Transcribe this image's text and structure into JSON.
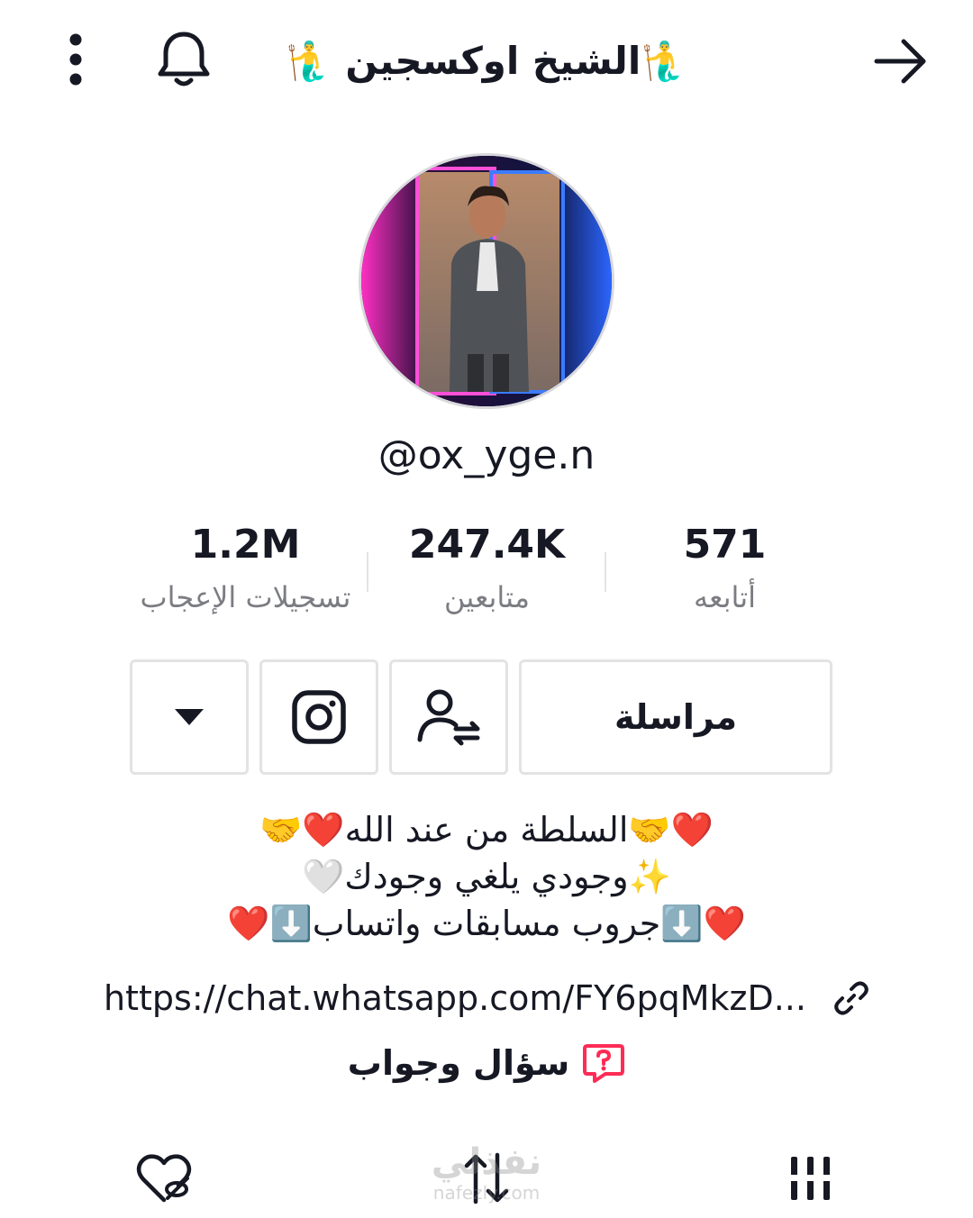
{
  "header": {
    "title": "🧜‍♂️الشيخ اوكسجين 🧜‍♂️"
  },
  "profile": {
    "username": "@ox_yge.n"
  },
  "stats": [
    {
      "value": "1.2M",
      "label": "تسجيلات الإعجاب"
    },
    {
      "value": "247.4K",
      "label": "متابعين"
    },
    {
      "value": "571",
      "label": "أتابعه"
    }
  ],
  "actions": {
    "message_label": "مراسلة"
  },
  "bio": {
    "lines": [
      "❤️🤝السلطة من عند الله❤️🤝",
      "✨وجودي يلغي وجودك🤍",
      "❤️⬇️جروب مسابقات واتساب⬇️❤️"
    ]
  },
  "link": {
    "text": "https://chat.whatsapp.com/FY6pqMkzD..."
  },
  "qa": {
    "label": "سؤال وجواب"
  },
  "watermark": {
    "ar": "نفذلي",
    "en": "nafezly.com"
  },
  "colors": {
    "text": "#161823",
    "muted": "#7c7d83",
    "border": "#e3e3e4",
    "accent": "#fe2c55"
  }
}
